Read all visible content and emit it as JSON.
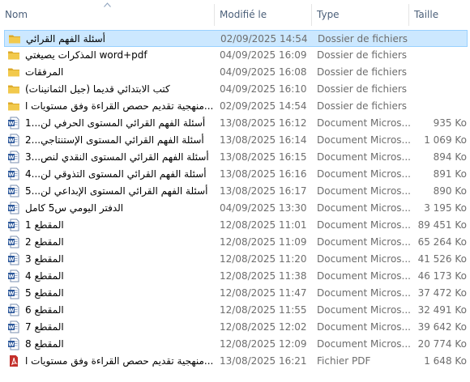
{
  "columns": {
    "name": "Nom",
    "modified": "Modifié le",
    "type": "Type",
    "size": "Taille"
  },
  "colors": {
    "selection_bg": "#cce8ff",
    "selection_border": "#99d1ff",
    "header_text": "#4c607a",
    "folder": "#e8b731",
    "word": "#2b579a",
    "pdf": "#c4302b"
  },
  "files": [
    {
      "name": "أسئلة الفهم القرائي",
      "modified": "02/09/2025 14:54",
      "type": "Dossier de fichiers",
      "size": "",
      "icon": "folder-icon",
      "selected": true
    },
    {
      "name": "المذكرات يصيغتي word+pdf",
      "modified": "04/09/2025 16:09",
      "type": "Dossier de fichiers",
      "size": "",
      "icon": "folder-icon"
    },
    {
      "name": "المرفقات",
      "modified": "04/09/2025 16:08",
      "type": "Dossier de fichiers",
      "size": "",
      "icon": "folder-icon"
    },
    {
      "name": "كتب الابتدائي قديما (جيل الثمانينات)",
      "modified": "04/09/2025 16:10",
      "type": "Dossier de fichiers",
      "size": "",
      "icon": "folder-icon"
    },
    {
      "name": "منهجية تقديم حصص القراءة وفق مستويات ا...",
      "modified": "02/09/2025 14:54",
      "type": "Dossier de fichiers",
      "size": "",
      "icon": "folder-icon"
    },
    {
      "name": "أسئلة الفهم القرائي المستوى الحرفي لن...1",
      "modified": "13/08/2025 16:12",
      "type": "Document Micros...",
      "size": "935 Ko",
      "icon": "word-document-icon"
    },
    {
      "name": "أسئلة الفهم القرائي المستوى الإستنتاجي...2",
      "modified": "13/08/2025 16:14",
      "type": "Document Micros...",
      "size": "1 069 Ko",
      "icon": "word-document-icon"
    },
    {
      "name": "أسئلة الفهم القرائي المستوى النقدي لنص...3",
      "modified": "13/08/2025 16:15",
      "type": "Document Micros...",
      "size": "894 Ko",
      "icon": "word-document-icon"
    },
    {
      "name": "أسئلة الفهم القرائي المستوى التذوقي لن...4",
      "modified": "13/08/2025 16:16",
      "type": "Document Micros...",
      "size": "891 Ko",
      "icon": "word-document-icon"
    },
    {
      "name": "أسئلة الفهم القرائي المستوى الإبداعي لن...5",
      "modified": "13/08/2025 16:17",
      "type": "Document Micros...",
      "size": "890 Ko",
      "icon": "word-document-icon"
    },
    {
      "name": "الدفتر اليومي س5 كامل",
      "modified": "04/09/2025 13:30",
      "type": "Document Micros...",
      "size": "3 195 Ko",
      "icon": "word-document-icon"
    },
    {
      "name": "المقطع 1",
      "modified": "12/08/2025 11:01",
      "type": "Document Micros...",
      "size": "89 451 Ko",
      "icon": "word-document-icon"
    },
    {
      "name": "المقطع 2",
      "modified": "12/08/2025 11:09",
      "type": "Document Micros...",
      "size": "65 264 Ko",
      "icon": "word-document-icon"
    },
    {
      "name": "المقطع 3",
      "modified": "12/08/2025 11:20",
      "type": "Document Micros...",
      "size": "41 526 Ko",
      "icon": "word-document-icon"
    },
    {
      "name": "المقطع 4",
      "modified": "12/08/2025 11:38",
      "type": "Document Micros...",
      "size": "46 173 Ko",
      "icon": "word-document-icon"
    },
    {
      "name": "المقطع 5",
      "modified": "12/08/2025 11:47",
      "type": "Document Micros...",
      "size": "37 472 Ko",
      "icon": "word-document-icon"
    },
    {
      "name": "المقطع 6",
      "modified": "12/08/2025 11:55",
      "type": "Document Micros...",
      "size": "32 491 Ko",
      "icon": "word-document-icon"
    },
    {
      "name": "المقطع 7",
      "modified": "12/08/2025 12:02",
      "type": "Document Micros...",
      "size": "39 642 Ko",
      "icon": "word-document-icon"
    },
    {
      "name": "المقطع 8",
      "modified": "12/08/2025 12:09",
      "type": "Document Micros...",
      "size": "20 774 Ko",
      "icon": "word-document-icon"
    },
    {
      "name": "منهجية تقديم حصص القراءة وفق مستويات ا...",
      "modified": "13/08/2025 16:21",
      "type": "Fichier PDF",
      "size": "1 648 Ko",
      "icon": "pdf-icon"
    }
  ]
}
